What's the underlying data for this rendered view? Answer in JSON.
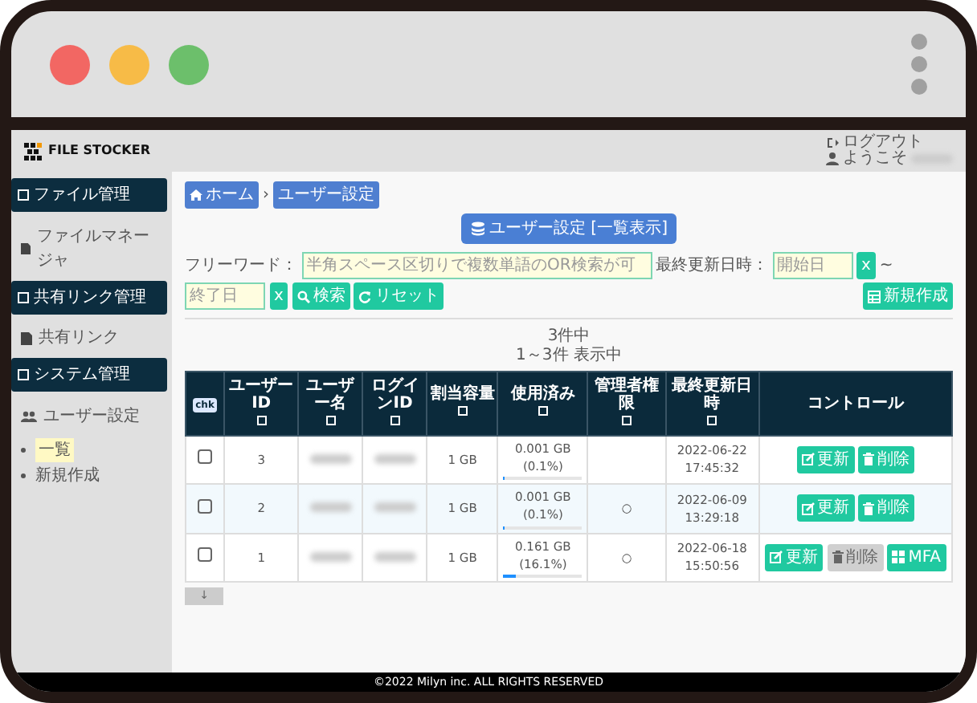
{
  "app_header": {
    "logo_text": "FILE STOCKER",
    "logout": "ログアウト",
    "welcome": "ようこそ"
  },
  "sidebar": {
    "sections": [
      {
        "title": "ファイル管理",
        "items": [
          {
            "label": "ファイルマネージャ",
            "kind": "file"
          }
        ]
      },
      {
        "title": "共有リンク管理",
        "items": [
          {
            "label": "共有リンク",
            "kind": "file"
          }
        ]
      },
      {
        "title": "システム管理",
        "items": [
          {
            "label": "ユーザー設定",
            "kind": "users",
            "children": [
              {
                "label": "一覧",
                "selected": true
              },
              {
                "label": "新規作成",
                "selected": false
              }
            ]
          }
        ]
      }
    ]
  },
  "breadcrumb_separator": "›",
  "breadcrumb": [
    {
      "label": "ホーム",
      "kind": "home"
    },
    {
      "label": "ユーザー設定",
      "kind": "plain"
    }
  ],
  "page_title": "ユーザー設定 [一覧表示]",
  "filter": {
    "freeword_label": "フリーワード：",
    "freeword_placeholder": "半角スペース区切りで複数単語のOR検索が可",
    "date_label": "最終更新日時：",
    "start_placeholder": "開始日",
    "start_clear": "x",
    "tilde": "~",
    "end_placeholder": "終了日",
    "end_clear": "x",
    "search_button": "検索",
    "reset_button": "リセット",
    "new_button": "新規作成"
  },
  "result_count": "3件中",
  "result_range": "1～3件 表示中",
  "table": {
    "columns": [
      "chk",
      "ユーザーID",
      "ユーザー名",
      "ログインID",
      "割当容量",
      "使用済み",
      "管理者権限",
      "最終更新日時",
      "コントロール"
    ],
    "rows": [
      {
        "selected": false,
        "checked": false,
        "id": "3",
        "quota": "1 GB",
        "used": "0.001 GB (0.1%)",
        "level": 0.001,
        "admin": "",
        "date": "2022-06-22",
        "time": "17:45:32",
        "actions": [
          {
            "label": "更新",
            "kind": "edit",
            "disabled": false
          },
          {
            "label": "削除",
            "kind": "delete",
            "disabled": false
          }
        ]
      },
      {
        "selected": true,
        "checked": false,
        "id": "2",
        "quota": "1 GB",
        "used": "0.001 GB (0.1%)",
        "level": 0.001,
        "admin": "○",
        "date": "2022-06-09",
        "time": "13:29:18",
        "actions": [
          {
            "label": "更新",
            "kind": "edit",
            "disabled": false
          },
          {
            "label": "削除",
            "kind": "delete",
            "disabled": false
          }
        ]
      },
      {
        "selected": false,
        "checked": false,
        "id": "1",
        "quota": "1 GB",
        "used": "0.161 GB (16.1%)",
        "level": 0.161,
        "admin": "○",
        "date": "2022-06-18",
        "time": "15:50:56",
        "actions": [
          {
            "label": "更新",
            "kind": "edit",
            "disabled": false
          },
          {
            "label": "削除",
            "kind": "delete",
            "disabled": true
          },
          {
            "label": "MFA",
            "kind": "mfa",
            "disabled": false
          }
        ]
      }
    ]
  },
  "scroll_button": "↓",
  "footer": "©2022 Milyn inc. ALL RIGHTS RESERVED"
}
